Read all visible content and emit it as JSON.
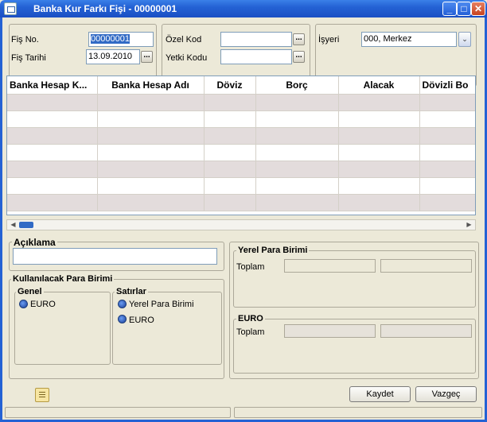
{
  "window": {
    "title": "Banka Kur Farkı Fişi - 00000001",
    "min_label": "_",
    "max_label": "□",
    "close_label": "✕"
  },
  "header": {
    "fis_no_label": "Fiş No.",
    "fis_no_value": "00000001",
    "fis_tarihi_label": "Fiş Tarihi",
    "fis_tarihi_value": "13.09.2010",
    "ozel_kod_label": "Özel Kod",
    "ozel_kod_value": "",
    "yetki_kodu_label": "Yetki Kodu",
    "yetki_kodu_value": "",
    "isyeri_label": "İşyeri",
    "isyeri_value": "000, Merkez",
    "dots_label": "...",
    "combo_arrow": "⌄"
  },
  "grid": {
    "columns": [
      "Banka Hesap K...",
      "Banka Hesap Adı",
      "Döviz",
      "Borç",
      "Alacak",
      "Dövizli Bo"
    ],
    "row_count": 7
  },
  "scroll": {
    "left_arrow": "◀",
    "right_arrow": "▶"
  },
  "aciklama": {
    "label": "Açıklama",
    "value": ""
  },
  "para_birimi": {
    "title": "Kullanılacak Para Birimi",
    "genel_title": "Genel",
    "genel_option": "EURO",
    "satirlar_title": "Satırlar",
    "satirlar_option1": "Yerel Para Birimi",
    "satirlar_option2": "EURO"
  },
  "yerel": {
    "title": "Yerel Para Birimi",
    "toplam_label": "Toplam"
  },
  "euro": {
    "title": "EURO",
    "toplam_label": "Toplam"
  },
  "buttons": {
    "kaydet": "Kaydet",
    "vazgec": "Vazgeç"
  },
  "colors": {
    "titlebar": "#2462d4",
    "selection": "#316ac5",
    "alt_row": "#e3dcdc"
  }
}
